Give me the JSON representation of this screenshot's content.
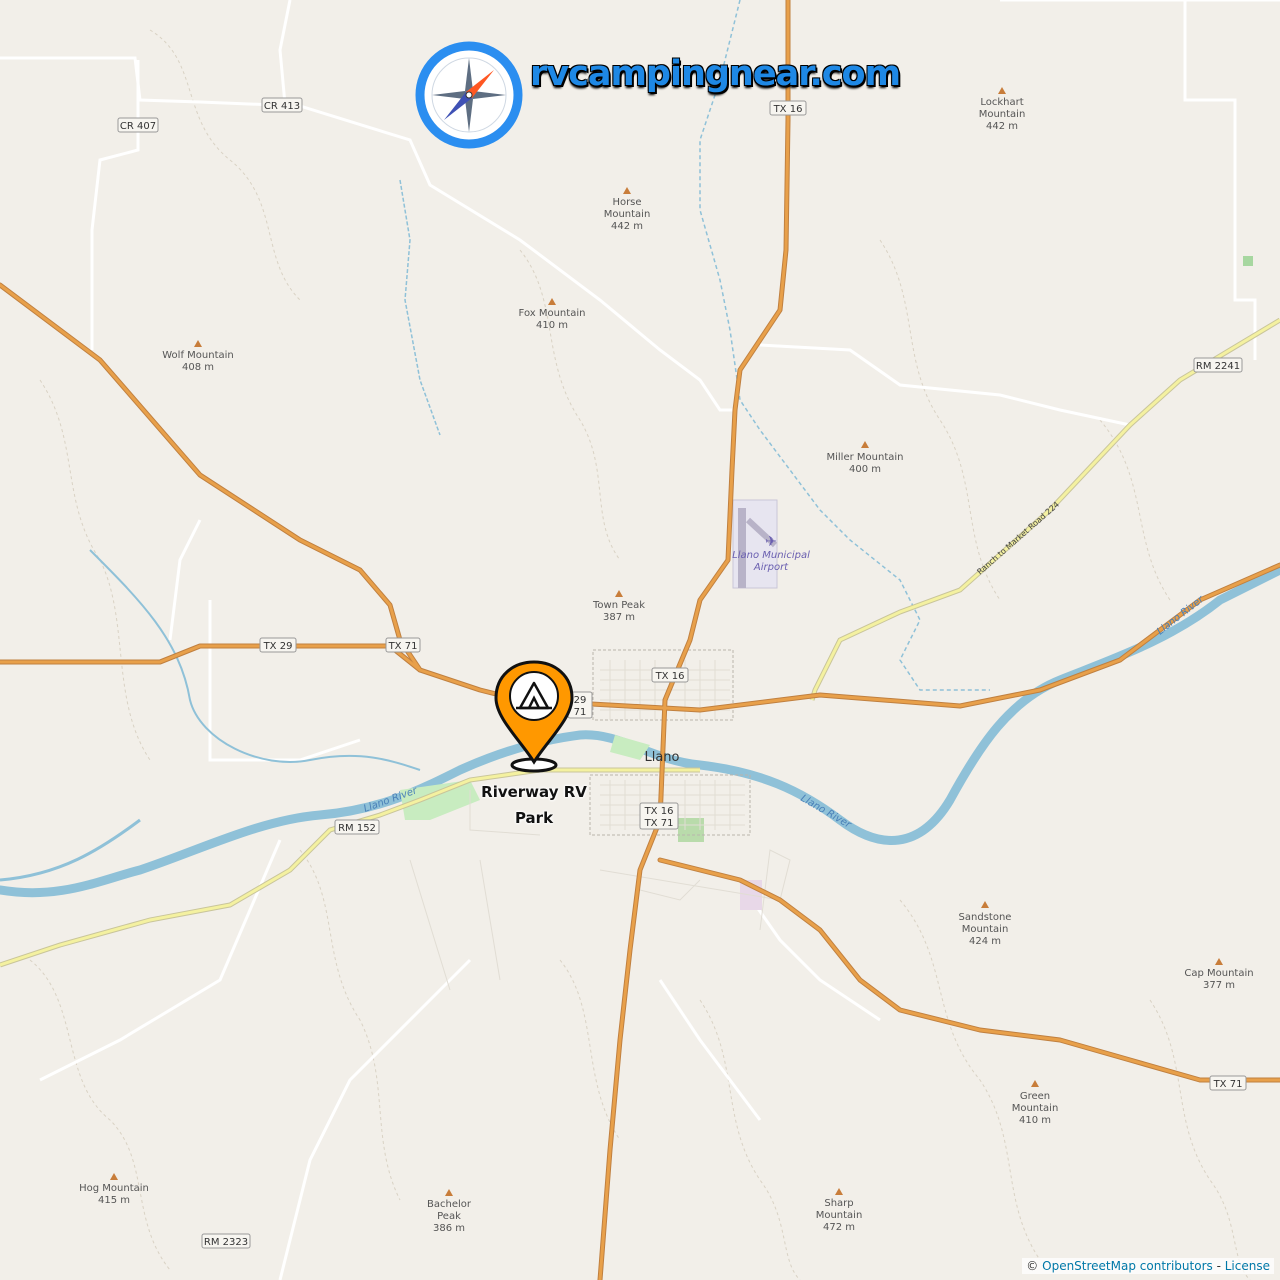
{
  "brand": {
    "name": "rvcampingnear.com",
    "accent": "#1e88e5",
    "icon": "compass-icon"
  },
  "marker": {
    "name_line1": "Riverway RV",
    "name_line2": "Park",
    "icon": "campground-tent-icon",
    "color": "#ff9800"
  },
  "town": {
    "name": "Llano"
  },
  "river": {
    "name": "Llano River"
  },
  "airport": {
    "line1": "Llano Municipal",
    "line2": "Airport"
  },
  "peaks": [
    {
      "name": [
        "Lockhart",
        "Mountain"
      ],
      "elev": "442 m"
    },
    {
      "name": [
        "Horse",
        "Mountain"
      ],
      "elev": "442 m"
    },
    {
      "name": [
        "Fox Mountain"
      ],
      "elev": "410 m"
    },
    {
      "name": [
        "Wolf Mountain"
      ],
      "elev": "408 m"
    },
    {
      "name": [
        "Miller Mountain"
      ],
      "elev": "400 m"
    },
    {
      "name": [
        "Town Peak"
      ],
      "elev": "387 m"
    },
    {
      "name": [
        "Sandstone",
        "Mountain"
      ],
      "elev": "424 m"
    },
    {
      "name": [
        "Cap Mountain"
      ],
      "elev": "377 m"
    },
    {
      "name": [
        "Green",
        "Mountain"
      ],
      "elev": "410 m"
    },
    {
      "name": [
        "Hog Mountain"
      ],
      "elev": "415 m"
    },
    {
      "name": [
        "Bachelor",
        "Peak"
      ],
      "elev": "386 m"
    },
    {
      "name": [
        "Sharp",
        "Mountain"
      ],
      "elev": "472 m"
    }
  ],
  "shields": [
    "CR 413",
    "CR 407",
    "TX 16",
    "TX 29",
    "TX 71",
    "RM 2241",
    "TX 16",
    "29",
    "71",
    "TX 16",
    "TX 71",
    "RM 152",
    "TX 71",
    "RM 2323"
  ],
  "road_names": {
    "rm2241": "Ranch to Market Road 2241"
  },
  "colors": {
    "land": "#f2efe9",
    "highway": "#e8a04a",
    "secondary": "#f4f1a0",
    "river": "#8fc1d8",
    "park": "#c8ecc0"
  },
  "attribution": {
    "prefix": "©",
    "link1": "OpenStreetMap contributors",
    "sep": "-",
    "link2": "License"
  }
}
